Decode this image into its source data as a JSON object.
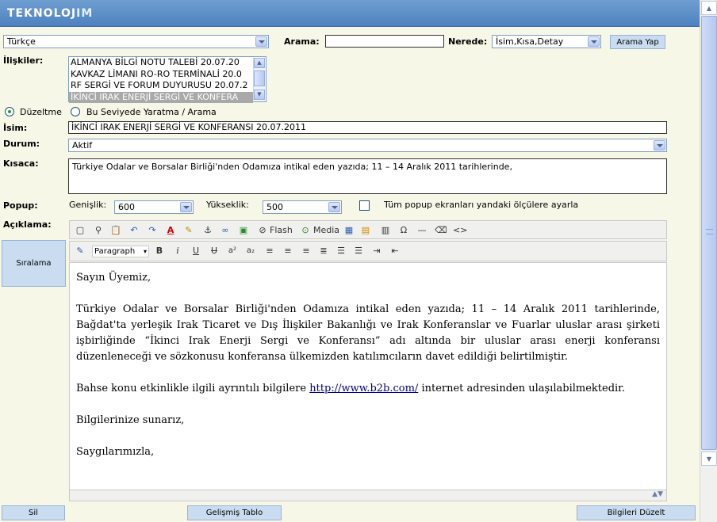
{
  "header": {
    "logo_main": "TEKNOLOJ",
    "logo_tail": "IM"
  },
  "top_row": {
    "language_value": "Türkçe",
    "search_label": "Arama:",
    "search_value": "",
    "where_label": "Nerede:",
    "where_value": "İsim,Kısa,Detay",
    "search_button": "Arama Yap"
  },
  "relations": {
    "label": "İlişkiler:",
    "items": [
      "ALMANYA BİLGİ NOTU TALEBİ 20.07.20",
      "KAVKAZ LİMANI RO-RO TERMİNALİ 20.0",
      "RF SERGİ VE FORUM DUYURUSU 20.07.2",
      "İKİNCİ IRAK ENERJİ SERGİ VE KONFERA"
    ],
    "selected_index": 3
  },
  "mode": {
    "edit_label": "Düzeltme",
    "create_label": "Bu Seviyede Yaratma / Arama",
    "selected": "edit"
  },
  "form": {
    "name_label": "İsim:",
    "name_value": "İKİNCİ IRAK ENERJİ SERGİ VE KONFERANSI 20.07.2011",
    "status_label": "Durum:",
    "status_value": "Aktif",
    "summary_label": "Kısaca:",
    "summary_value": "Türkiye Odalar ve Borsalar Birliği'nden Odamıza intikal eden yazıda; 11 – 14 Aralık 2011 tarihlerinde,",
    "popup_label": "Popup:",
    "width_label": "Genişlik:",
    "width_value": "600",
    "height_label": "Yükseklik:",
    "height_value": "500",
    "all_popups_label": "Tüm popup ekranları yandaki ölçülere ayarla",
    "description_label": "Açıklama:",
    "sort_button": "Sıralama"
  },
  "editor": {
    "flash_label": "Flash",
    "media_label": "Media",
    "format_value": "Paragraph",
    "greeting": "Sayın Üyemiz,",
    "paragraph1": "Türkiye Odalar ve Borsalar Birliği'nden Odamıza intikal eden yazıda; 11 – 14 Aralık 2011 tarihlerinde, Bağdat'ta yerleşik Irak Ticaret ve Dış İlişkiler Bakanlığı ve Irak Konferanslar ve Fuarlar uluslar arası şirketi işbirliğinde “İkinci Irak Enerji Sergi ve Konferansı” adı altında bir uluslar arası enerji konferansı düzenleneceği ve sözkonusu konferansa ülkemizden katılımcıların davet edildiği belirtilmiştir.",
    "paragraph2_before": "Bahse konu etkinlikle ilgili ayrıntılı bilgilere ",
    "paragraph2_link": "http://www.b2b.com/",
    "paragraph2_after": " internet adresinden ulaşılabilmektedir.",
    "paragraph3": "Bilgilerinize sunarız,",
    "closing": "Saygılarımızla,"
  },
  "bottom": {
    "delete_button": "Sil",
    "advanced_table_button": "Gelişmiş Tablo",
    "update_button": "Bilgileri Düzelt"
  }
}
